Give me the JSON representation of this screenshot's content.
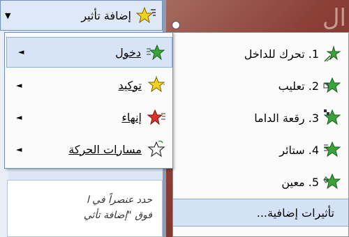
{
  "toolbar": {
    "add_effect_label": "إضافة تأثير",
    "dropdown_arrow": "▼"
  },
  "menu": {
    "items": [
      {
        "label": "دخول",
        "icon": "entrance-star-icon",
        "arrow": "◄"
      },
      {
        "label": "توكيد",
        "icon": "emphasis-star-icon",
        "arrow": "◄"
      },
      {
        "label": "إنهاء",
        "icon": "exit-star-icon",
        "arrow": "◄"
      },
      {
        "label": "مسارات الحركة",
        "icon": "motion-path-star-icon",
        "arrow": "◄"
      }
    ]
  },
  "submenu": {
    "items": [
      {
        "label": "1. تحرك للداخل",
        "icon": "fly-in-icon"
      },
      {
        "label": "2. تعليب",
        "icon": "box-effect-icon"
      },
      {
        "label": "3. رقعة الداما",
        "icon": "checkerboard-effect-icon"
      },
      {
        "label": "4. ستائر",
        "icon": "blinds-effect-icon"
      },
      {
        "label": "5. معين",
        "icon": "diamond-effect-icon"
      }
    ],
    "more_label": "تأثيرات إضافية..."
  },
  "pane": {
    "hint_line1": "حدد عنصراً في ا",
    "hint_line2": "فوق \"إضافة تأثي"
  },
  "slide": {
    "text": "ال"
  },
  "colors": {
    "menu_highlight": "#d7e4f7",
    "star_green": "#3aa33a",
    "star_yellow": "#f2d21b",
    "star_red": "#e0302a"
  }
}
